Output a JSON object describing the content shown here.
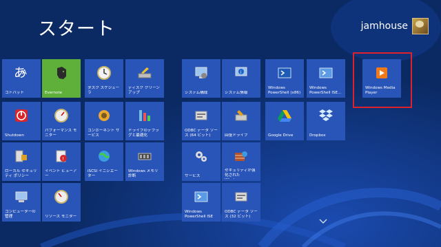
{
  "screen": {
    "title": "スタート",
    "user_name": "jamhouse"
  },
  "colors": {
    "background": "#0b2a64",
    "tile": "#2a55b8",
    "evernote_tile": "#5fb03a",
    "highlight": "#e0202a"
  },
  "tiles": {
    "kotobato": "コトバット",
    "evernote": "Evernote",
    "task_scheduler": "タスク スケジューラ",
    "disk_cleanup": "ディスク クリーンアップ",
    "system_config": "システム構成",
    "system_info": "システム情報",
    "ps_x86": "Windows PowerShell (x86)",
    "ps_ise_x86": "Windows PowerShell ISE...",
    "wmp": "Windows Media Player",
    "shutdown": "Shutdown",
    "perfmon": "パフォーマンス モニター",
    "component_services": "コンポーネント サービス",
    "defrag": "ドライブのデフラグと最適化",
    "odbc64": "ODBC データ ソース (64 ビット)",
    "recovery": "回復ドライブ",
    "google_drive": "Google Drive",
    "dropbox": "Dropbox",
    "local_security": "ローカル セキュリティ ポリシー",
    "event_viewer": "イベント ビューアー",
    "iscsi": "iSCSI イニシエーター",
    "mem_diag": "Windows メモリ診断",
    "services": "サービス",
    "firewall": "セキュリティが強化された Window...",
    "computer_mgmt": "コンピューターの管理",
    "resmon": "リソース モニター",
    "ps_ise": "Windows PowerShell ISE",
    "odbc32": "ODBC データ ソース (32 ビット)"
  }
}
